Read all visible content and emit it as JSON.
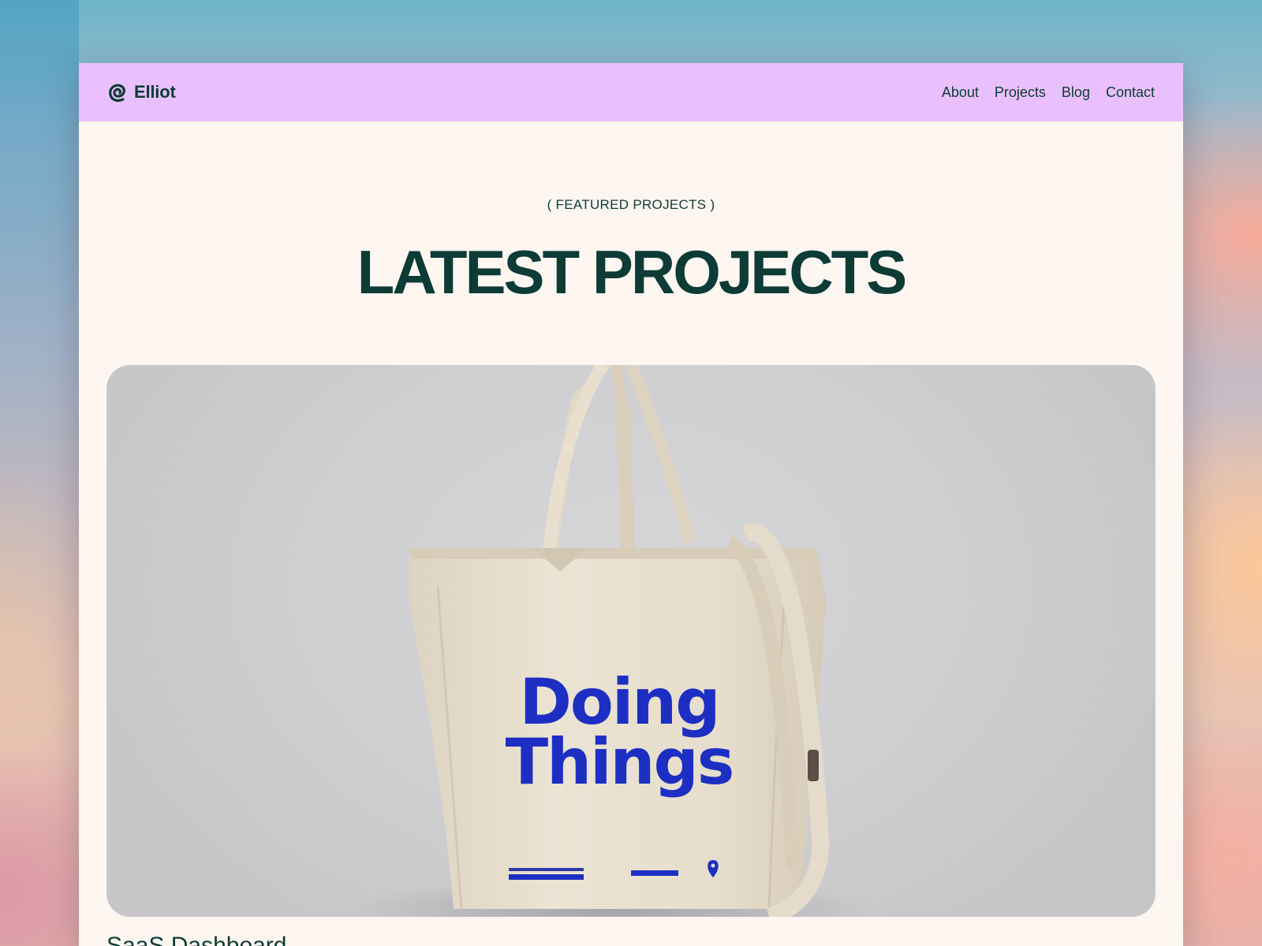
{
  "brand": {
    "name": "Elliot",
    "logo_icon": "swirl-logo-icon"
  },
  "nav": {
    "links": [
      {
        "label": "About"
      },
      {
        "label": "Projects"
      },
      {
        "label": "Blog"
      },
      {
        "label": "Contact"
      }
    ]
  },
  "section": {
    "eyebrow": "( FEATURED PROJECTS )",
    "title": "LATEST PROJECTS"
  },
  "project": {
    "image_slogan_line1": "Doing",
    "image_slogan_line2": "Things",
    "title": "SaaS Dashboard"
  },
  "colors": {
    "navbar": "#e9c0fd",
    "page": "#fdf6f1",
    "text": "#0d3b35",
    "bag_print": "#1d2fc2"
  }
}
